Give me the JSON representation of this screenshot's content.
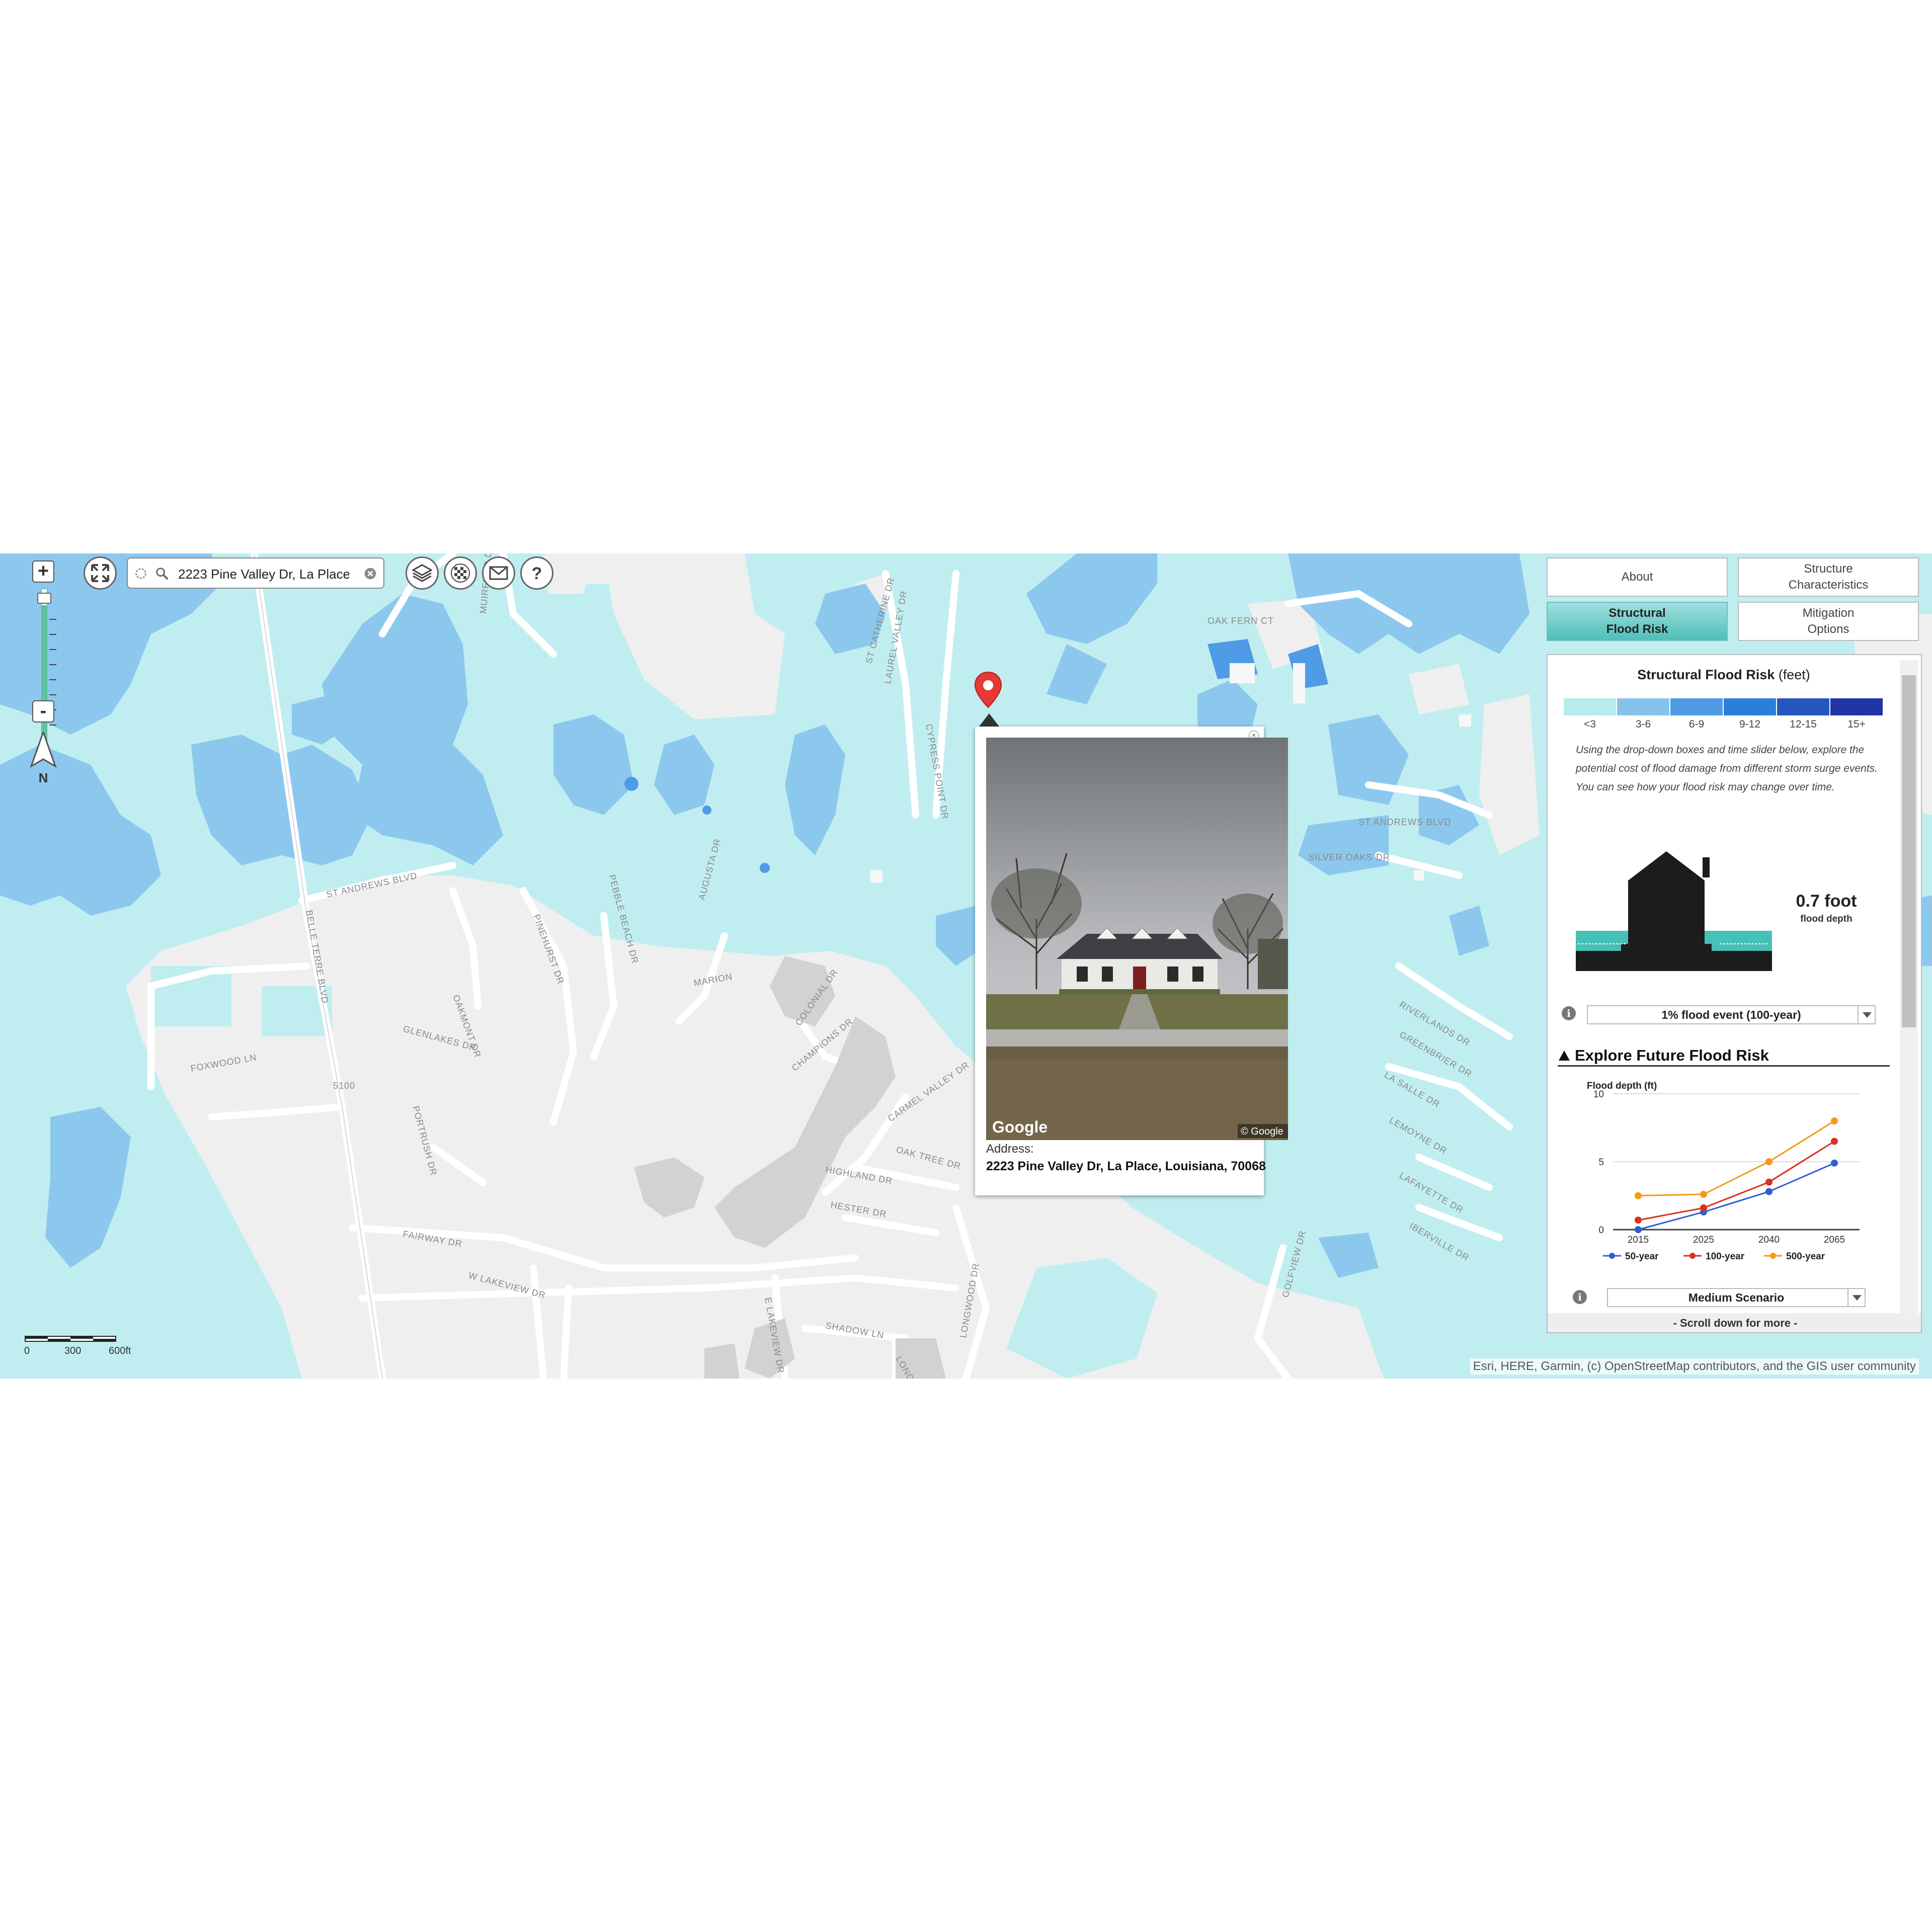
{
  "search": {
    "query": "2223 Pine Valley Dr, La Place,"
  },
  "zoom": {
    "in_label": "+",
    "out_label": "-"
  },
  "north_label": "N",
  "scale": {
    "labels": [
      "0",
      "300",
      "600ft"
    ]
  },
  "attribution": "Esri, HERE, Garmin, (c) OpenStreetMap contributors, and the GIS user community",
  "road_labels": [
    "ST ANDREWS BLVD",
    "BELLE TERRE BLVD",
    "OAKMONT DR",
    "GLENLAKES DR",
    "FOXWOOD LN",
    "PORTRUSH DR",
    "FAIRWAY DR",
    "W LAKEVIEW DR",
    "E LAKEVIEW DR",
    "PINEHURST DR",
    "MARION",
    "COLONIAL DR",
    "CHAMPIONS DR",
    "CARMEL VALLEY DR",
    "OAK TREE DR",
    "HIGHLAND DR",
    "HESTER DR",
    "SHADOW LN",
    "LONGWOOD DR",
    "LONGWOOD CT",
    "GOLFVIEW DR",
    "PEBBLE BEACH DR",
    "AUGUSTA DR",
    "LAUREL VALLEY DR",
    "CYPRESS POINT DR",
    "OAK FERN CT",
    "ST ANDREWS BLVD",
    "SILVER OAKS DR",
    "RIVERLANDS DR",
    "GREENBRIER DR",
    "LA SALLE DR",
    "LEMOYNE DR",
    "LAFAYETTE DR",
    "IBERVILLE DR",
    "5100",
    "MUIRFIELD DR",
    "ST CATHERINE DR"
  ],
  "popup": {
    "close": "×",
    "address_label": "Address:",
    "address": "2223 Pine Valley Dr, La Place, Louisiana, 70068",
    "photo_logo": "Google",
    "photo_copyright": "© Google"
  },
  "tabs": [
    {
      "label": "About",
      "active": false
    },
    {
      "label": "Structure Characteristics",
      "active": false
    },
    {
      "label": "Structural Flood Risk",
      "active": true
    },
    {
      "label": "Mitigation Options",
      "active": false
    }
  ],
  "panel": {
    "title": "Structural Flood Risk",
    "title_unit": "(feet)",
    "legend": [
      {
        "label": "<3",
        "color": "#b6ecee"
      },
      {
        "label": "3-6",
        "color": "#86c3ec"
      },
      {
        "label": "6-9",
        "color": "#4f9be6"
      },
      {
        "label": "9-12",
        "color": "#2b7fdc"
      },
      {
        "label": "12-15",
        "color": "#2657c0"
      },
      {
        "label": "15+",
        "color": "#1f35a6"
      }
    ],
    "intro": "Using the drop-down boxes and time slider below, explore the potential cost of flood damage from different storm surge events. You can see how your flood risk may change over time.",
    "depth_value": "0.7 foot",
    "depth_label": "flood depth",
    "event_select": "1% flood event (100-year)",
    "future_heading": "Explore Future Flood Risk",
    "scenario_select": "Medium Scenario",
    "scroll_hint": "- Scroll down for more -",
    "info_icon": "i"
  },
  "chart_data": {
    "type": "line",
    "ylabel": "Flood depth (ft)",
    "x": [
      "2015",
      "2025",
      "2040",
      "2065"
    ],
    "ylim": [
      0,
      10
    ],
    "yticks": [
      0,
      5,
      10
    ],
    "series": [
      {
        "name": "50-year",
        "color": "#2e5fd0",
        "values": [
          0.0,
          1.3,
          2.8,
          4.9
        ]
      },
      {
        "name": "100-year",
        "color": "#d9321f",
        "values": [
          0.7,
          1.6,
          3.5,
          6.5
        ]
      },
      {
        "name": "500-year",
        "color": "#f39a14",
        "values": [
          2.5,
          2.6,
          5.0,
          8.0
        ]
      }
    ]
  }
}
